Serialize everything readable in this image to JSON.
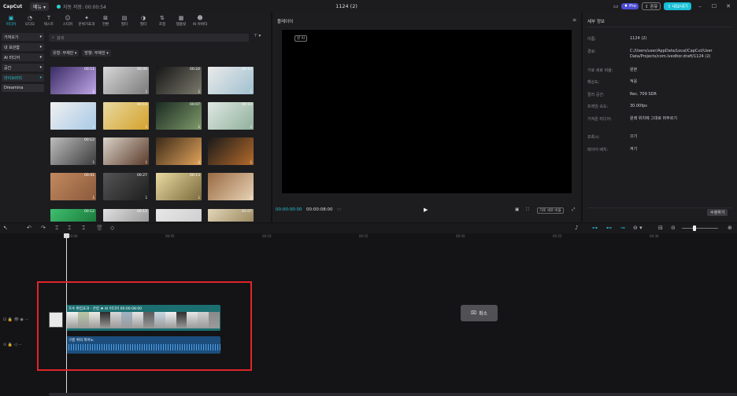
{
  "titlebar": {
    "logo": "CapCut",
    "menu": "메뉴",
    "autosave": "자동 저장: 00:00:54",
    "window_title": "1124 (2)",
    "pro": "Pro",
    "share": "공유",
    "export": "내보내기"
  },
  "toolbar": [
    {
      "icon": "media-icon",
      "label": "미디어",
      "active": true
    },
    {
      "icon": "audio-icon",
      "label": "오디오"
    },
    {
      "icon": "text-icon",
      "label": "텍스트"
    },
    {
      "icon": "sticker-icon",
      "label": "스티커"
    },
    {
      "icon": "effects-icon",
      "label": "분위기효과"
    },
    {
      "icon": "transition-icon",
      "label": "전환"
    },
    {
      "icon": "filter-icon",
      "label": "필터"
    },
    {
      "icon": "color-icon",
      "label": "필터"
    },
    {
      "icon": "adjust-icon",
      "label": "조정"
    },
    {
      "icon": "template-icon",
      "label": "템플릿"
    },
    {
      "icon": "ai-avatar-icon",
      "label": "AI 아바타"
    }
  ],
  "sidebar": [
    {
      "label": "가져오기"
    },
    {
      "label": "내 보관함"
    },
    {
      "label": "AI 미디어"
    },
    {
      "label": "공간"
    },
    {
      "label": "라이브러리",
      "active": true
    },
    {
      "label": "Dreamina",
      "plain": true
    }
  ],
  "search": {
    "placeholder": "검색"
  },
  "filters": {
    "type": "유형: 무제한",
    "direction": "방향: 무제한"
  },
  "media": [
    {
      "dur": "00:11",
      "c1": "#3a2b63",
      "c2": "#c0a6e8"
    },
    {
      "dur": "00:06",
      "c1": "#d7d7d7",
      "c2": "#7a7a7a"
    },
    {
      "dur": "00:24",
      "c1": "#161616",
      "c2": "#7c7a6c"
    },
    {
      "dur": "00:12",
      "c1": "#eaeaea",
      "c2": "#9fc0cf"
    },
    {
      "dur": "",
      "c1": "#f0f0f0",
      "c2": "#a8c9e6"
    },
    {
      "dur": "00:16",
      "c1": "#e9d9a0",
      "c2": "#d3a12b"
    },
    {
      "dur": "00:07",
      "c1": "#1b2b22",
      "c2": "#7f9a6a"
    },
    {
      "dur": "00:10",
      "c1": "#dfe8e3",
      "c2": "#8fb09b"
    },
    {
      "dur": "00:12",
      "c1": "#bdbdbd",
      "c2": "#3c3c3c"
    },
    {
      "dur": "",
      "c1": "#d9d2c8",
      "c2": "#5b3b2a"
    },
    {
      "dur": "",
      "c1": "#3b2a19",
      "c2": "#e2a35a"
    },
    {
      "dur": "",
      "c1": "#1a1a1a",
      "c2": "#b46a2b"
    },
    {
      "dur": "00:41",
      "c1": "#c2895f",
      "c2": "#8a5a3c"
    },
    {
      "dur": "00:27",
      "c1": "#555",
      "c2": "#1d1d1d"
    },
    {
      "dur": "00:13",
      "c1": "#e9d9a0",
      "c2": "#7a6a3c"
    },
    {
      "dur": "",
      "c1": "#9a6a43",
      "c2": "#e7d3b6"
    },
    {
      "dur": "00:12",
      "c1": "#3fbf6f",
      "c2": "#1b7b3c"
    },
    {
      "dur": "00:12",
      "c1": "#e0e0e0",
      "c2": "#9a9a9a"
    },
    {
      "dur": "",
      "c1": "#e8e8e8",
      "c2": "#cfcfcf"
    },
    {
      "dur": "01:07",
      "c1": "#e2d6b8",
      "c2": "#9b8a60"
    }
  ],
  "player": {
    "title": "플레이어",
    "ratio": "원 AI",
    "current": "00:00:00:00",
    "total": "00:00:08:00",
    "ratio_btn": "가로 세로 비율"
  },
  "details": {
    "title": "세부 정보",
    "rows": [
      {
        "k": "이름:",
        "v": "1124 (2)"
      },
      {
        "k": "경로:",
        "v": "C:/Users/user/AppData/Local/CapCut/User Data/Projects/com.lveditor.draft/1124 (2)"
      },
      {
        "k": "가로 세로 비율:",
        "v": "원본"
      },
      {
        "k": "해상도:",
        "v": "적응"
      },
      {
        "k": "컬러 공간:",
        "v": "Rec. 709 SDR"
      },
      {
        "k": "프레임 속도:",
        "v": "30.00fps"
      },
      {
        "k": "가져온 미디어:",
        "v": "원래 위치에 그대로 머무르기"
      },
      {
        "k": "프록시:",
        "v": "끄기"
      },
      {
        "k": "레이어 배치:",
        "v": "켜기"
      }
    ],
    "modify": "수정하기"
  },
  "ruler": [
    "00:00",
    "00:05",
    "00:10",
    "00:15",
    "00:20",
    "00:25",
    "00:30",
    "00:35"
  ],
  "timeline": {
    "video_clip_label": "흐수 편집효과 - 큰컴  ❖ AI 미디어  00:00:08:00",
    "audio_clip_label": "구름 위의 피아노",
    "cover_label": "커버",
    "cancel": "취소"
  }
}
